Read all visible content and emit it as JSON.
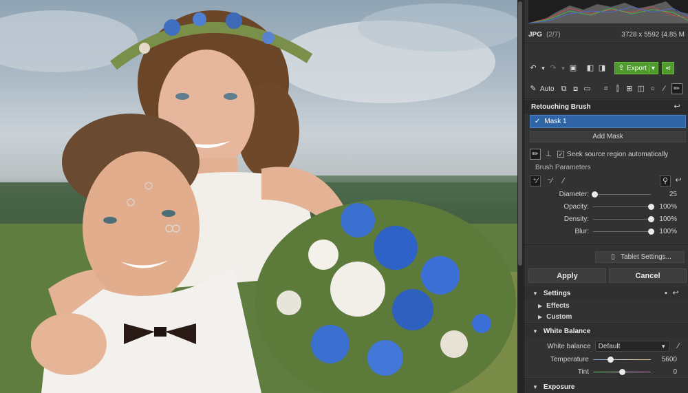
{
  "file": {
    "format": "JPG",
    "position": "(2/7)",
    "dimensions": "3728 x 5592 (4.85 M"
  },
  "toolbar": {
    "export_label": "Export",
    "auto_label": "Auto"
  },
  "tool": {
    "title": "Retouching Brush"
  },
  "masks": {
    "items": [
      {
        "label": "Mask 1",
        "checked": true
      }
    ],
    "add_label": "Add Mask"
  },
  "seek_source": {
    "label": "Seek source region automatically",
    "checked": true
  },
  "brush_params": {
    "label": "Brush Parameters",
    "sliders": [
      {
        "label": "Diameter:",
        "value": "25",
        "fraction": 0.02
      },
      {
        "label": "Opacity:",
        "value": "100%",
        "fraction": 1.0
      },
      {
        "label": "Density:",
        "value": "100%",
        "fraction": 1.0
      },
      {
        "label": "Blur:",
        "value": "100%",
        "fraction": 1.0
      }
    ]
  },
  "tablet_settings_label": "Tablet Settings...",
  "actions": {
    "apply": "Apply",
    "cancel": "Cancel"
  },
  "sections": {
    "settings": "Settings",
    "effects": "Effects",
    "custom": "Custom",
    "white_balance": "White Balance",
    "exposure": "Exposure"
  },
  "white_balance": {
    "label": "White balance",
    "selected": "Default",
    "temperature": {
      "label": "Temperature",
      "value": "5600",
      "fraction": 0.3
    },
    "tint": {
      "label": "Tint",
      "value": "0",
      "fraction": 0.5
    }
  },
  "colors": {
    "accent_green": "#4f9a2d",
    "selection_blue": "#2f64a6"
  }
}
